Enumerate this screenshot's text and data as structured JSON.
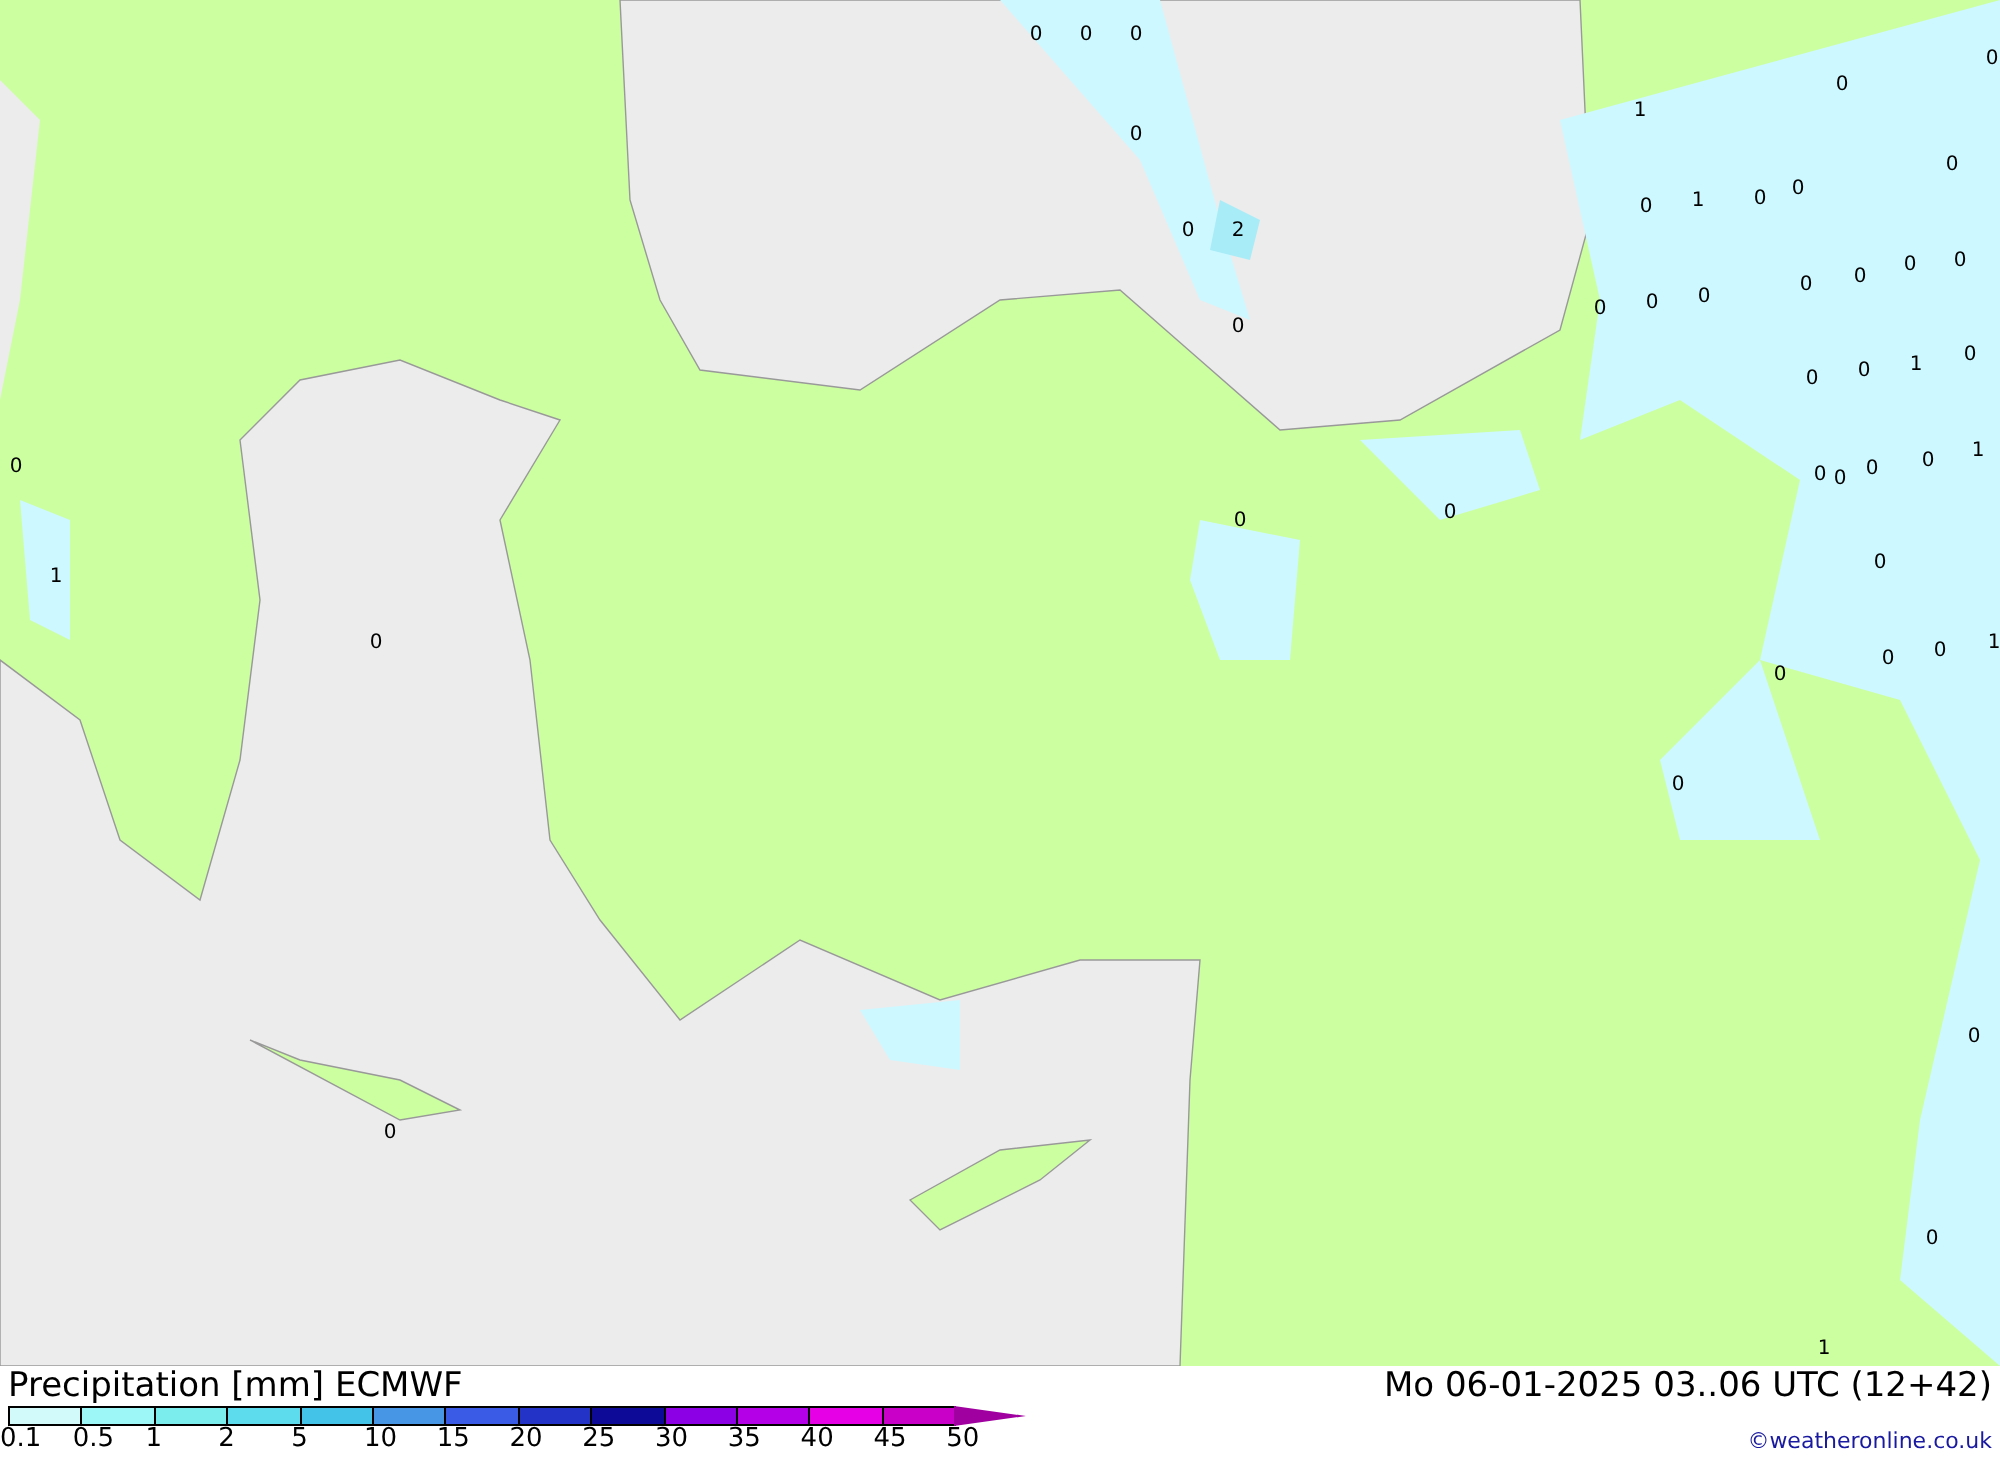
{
  "map": {
    "labels": [
      "0",
      "0",
      "0",
      "0",
      "0",
      "2",
      "0",
      "0",
      "1",
      "0",
      "0",
      "0",
      "0",
      "1",
      "0",
      "0",
      "0",
      "1",
      "0",
      "0",
      "0",
      "0",
      "0",
      "0",
      "0",
      "0",
      "0",
      "1",
      "0",
      "0",
      "0",
      "0",
      "0",
      "1",
      "0",
      "0",
      "0",
      "1",
      "0",
      "0",
      "0",
      "0",
      "1",
      "0",
      "0",
      "0"
    ]
  },
  "legend": {
    "title": "Precipitation [mm] ECMWF",
    "date": "Mo 06-01-2025 03..06 UTC (12+42)",
    "credit": "©weatheronline.co.uk",
    "steps": [
      {
        "label": "0.1",
        "color": "#d2fafa"
      },
      {
        "label": "0.5",
        "color": "#9ef7f7"
      },
      {
        "label": "1",
        "color": "#7ceded"
      },
      {
        "label": "2",
        "color": "#5cdcec"
      },
      {
        "label": "5",
        "color": "#44c3e8"
      },
      {
        "label": "10",
        "color": "#4796e6"
      },
      {
        "label": "15",
        "color": "#3a5be6"
      },
      {
        "label": "20",
        "color": "#2333c8"
      },
      {
        "label": "25",
        "color": "#0c0a96"
      },
      {
        "label": "30",
        "color": "#8c00e6"
      },
      {
        "label": "35",
        "color": "#b400e6"
      },
      {
        "label": "40",
        "color": "#e600e6"
      },
      {
        "label": "45",
        "color": "#c800c8"
      },
      {
        "label": "50",
        "color": "#a000a0"
      }
    ]
  }
}
